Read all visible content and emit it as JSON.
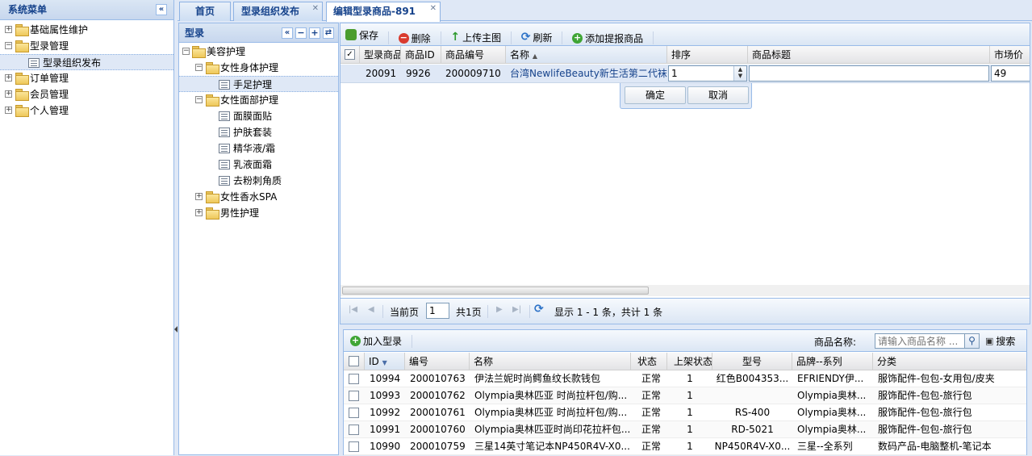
{
  "left_menu": {
    "title": "系统菜单",
    "items": [
      {
        "label": "基础属性维护"
      },
      {
        "label": "型录管理"
      },
      {
        "label": "型录组织发布"
      },
      {
        "label": "订单管理"
      },
      {
        "label": "会员管理"
      },
      {
        "label": "个人管理"
      }
    ]
  },
  "tabs": [
    {
      "label": "首页"
    },
    {
      "label": "型录组织发布"
    },
    {
      "label": "编辑型录商品-891"
    }
  ],
  "catalog_tree": {
    "title": "型录",
    "nodes": [
      {
        "label": "美容护理"
      },
      {
        "label": "女性身体护理"
      },
      {
        "label": "手足护理"
      },
      {
        "label": "女性面部护理"
      },
      {
        "label": "面膜面贴"
      },
      {
        "label": "护肤套装"
      },
      {
        "label": "精华液/霜"
      },
      {
        "label": "乳液面霜"
      },
      {
        "label": "去粉刺角质"
      },
      {
        "label": "女性香水SPA"
      },
      {
        "label": "男性护理"
      }
    ]
  },
  "editor": {
    "toolbar": {
      "save": "保存",
      "delete": "删除",
      "upload": "上传主图",
      "refresh": "刷新",
      "add": "添加提报商品"
    },
    "columns": [
      "型录商品",
      "商品ID",
      "商品编号",
      "名称",
      "排序",
      "商品标题",
      "市场价"
    ],
    "row": {
      "catalog_item": "20091",
      "product_id": "9926",
      "product_code": "200009710",
      "name": "台湾NewlifeBeauty新生活第二代袜套",
      "sort": "1",
      "title": "",
      "market_price": "49"
    },
    "confirm": "确定",
    "cancel": "取消",
    "pager": {
      "current_label": "当前页",
      "page": "1",
      "total_pages": "共1页",
      "display": "显示 1 - 1 条，共计 1 条"
    }
  },
  "product_panel": {
    "add_button": "加入型录",
    "search_label": "商品名称:",
    "search_placeholder": "请输入商品名称 ...",
    "search_button": "搜索",
    "columns": [
      "ID",
      "编号",
      "名称",
      "状态",
      "上架状态",
      "型号",
      "品牌--系列",
      "分类"
    ],
    "rows": [
      {
        "id": "10994",
        "code": "200010763",
        "name": "伊法兰妮时尚鳄鱼纹长款钱包",
        "status": "正常",
        "shelf": "1",
        "model": "红色B004353...",
        "brand": "EFRIENDY伊...",
        "category": "服饰配件-包包-女用包/皮夹"
      },
      {
        "id": "10993",
        "code": "200010762",
        "name": "Olympia奥林匹亚 时尚拉杆包/购...",
        "status": "正常",
        "shelf": "1",
        "model": "",
        "brand": "Olympia奥林...",
        "category": "服饰配件-包包-旅行包"
      },
      {
        "id": "10992",
        "code": "200010761",
        "name": "Olympia奥林匹亚 时尚拉杆包/购...",
        "status": "正常",
        "shelf": "1",
        "model": "RS-400",
        "brand": "Olympia奥林...",
        "category": "服饰配件-包包-旅行包"
      },
      {
        "id": "10991",
        "code": "200010760",
        "name": "Olympia奥林匹亚时尚印花拉杆包...",
        "status": "正常",
        "shelf": "1",
        "model": "RD-5021",
        "brand": "Olympia奥林...",
        "category": "服饰配件-包包-旅行包"
      },
      {
        "id": "10990",
        "code": "200010759",
        "name": "三星14英寸笔记本NP450R4V-X0...",
        "status": "正常",
        "shelf": "1",
        "model": "NP450R4V-X0...",
        "brand": "三星--全系列",
        "category": "数码产品-电脑整机-笔记本"
      }
    ]
  },
  "colors": {
    "header_text": "#15428b",
    "border": "#99bbe8",
    "selected": "#dfe8f6",
    "link": "#15428b"
  }
}
